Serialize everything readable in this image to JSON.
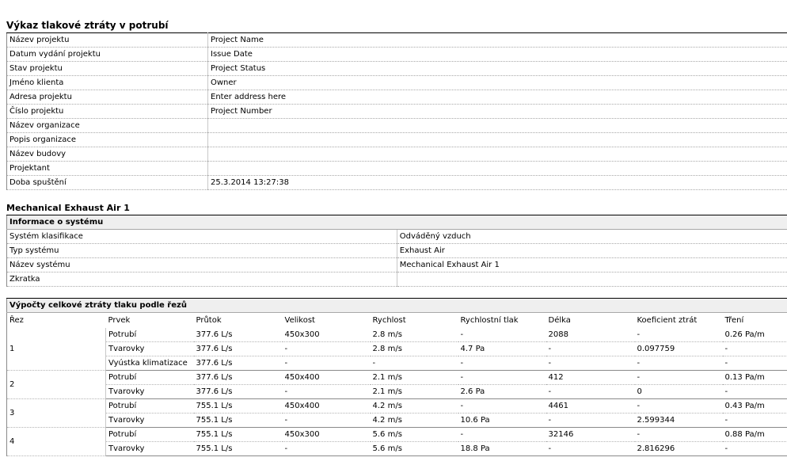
{
  "report_title": "Výkaz tlakové ztráty v potrubí",
  "project_info": [
    {
      "label": "Název projektu",
      "value": "Project Name"
    },
    {
      "label": "Datum vydání projektu",
      "value": "Issue Date"
    },
    {
      "label": "Stav projektu",
      "value": "Project Status"
    },
    {
      "label": "Jméno klienta",
      "value": "Owner"
    },
    {
      "label": "Adresa projektu",
      "value": "Enter address here"
    },
    {
      "label": "Číslo projektu",
      "value": "Project Number"
    },
    {
      "label": "Název organizace",
      "value": ""
    },
    {
      "label": "Popis organizace",
      "value": ""
    },
    {
      "label": "Název budovy",
      "value": ""
    },
    {
      "label": "Projektant",
      "value": ""
    },
    {
      "label": "Doba spuštění",
      "value": "25.3.2014 13:27:38"
    }
  ],
  "system": {
    "name": "Mechanical Exhaust Air 1",
    "info_header": "Informace o systému",
    "info": [
      {
        "label": "Systém klasifikace",
        "value": "Odváděný vzduch"
      },
      {
        "label": "Typ systému",
        "value": "Exhaust Air"
      },
      {
        "label": "Název systému",
        "value": "Mechanical Exhaust Air 1"
      },
      {
        "label": "Zkratka",
        "value": ""
      }
    ]
  },
  "pressure_calc": {
    "title": "Výpočty celkové ztráty tlaku podle řezů",
    "columns": [
      "Řez",
      "Prvek",
      "Průtok",
      "Velikost",
      "Rychlost",
      "Rychlostní tlak",
      "Délka",
      "Koeficient ztrát",
      "Tření"
    ],
    "sections": [
      {
        "id": "1",
        "rows": [
          {
            "prvek": "Potrubí",
            "prutok": "377.6 L/s",
            "velikost": "450x300",
            "rychlost": "2.8 m/s",
            "tlak": "-",
            "delka": "2088",
            "koef": "-",
            "treni": "0.26 Pa/m"
          },
          {
            "prvek": "Tvarovky",
            "prutok": "377.6 L/s",
            "velikost": "-",
            "rychlost": "2.8 m/s",
            "tlak": "4.7 Pa",
            "delka": "-",
            "koef": "0.097759",
            "treni": "-"
          },
          {
            "prvek": "Vyústka klimatizace",
            "prutok": "377.6 L/s",
            "velikost": "-",
            "rychlost": "-",
            "tlak": "-",
            "delka": "-",
            "koef": "-",
            "treni": "-"
          }
        ]
      },
      {
        "id": "2",
        "rows": [
          {
            "prvek": "Potrubí",
            "prutok": "377.6 L/s",
            "velikost": "450x400",
            "rychlost": "2.1 m/s",
            "tlak": "-",
            "delka": "412",
            "koef": "-",
            "treni": "0.13 Pa/m"
          },
          {
            "prvek": "Tvarovky",
            "prutok": "377.6 L/s",
            "velikost": "-",
            "rychlost": "2.1 m/s",
            "tlak": "2.6 Pa",
            "delka": "-",
            "koef": "0",
            "treni": "-"
          }
        ]
      },
      {
        "id": "3",
        "rows": [
          {
            "prvek": "Potrubí",
            "prutok": "755.1 L/s",
            "velikost": "450x400",
            "rychlost": "4.2 m/s",
            "tlak": "-",
            "delka": "4461",
            "koef": "-",
            "treni": "0.43 Pa/m"
          },
          {
            "prvek": "Tvarovky",
            "prutok": "755.1 L/s",
            "velikost": "-",
            "rychlost": "4.2 m/s",
            "tlak": "10.6 Pa",
            "delka": "-",
            "koef": "2.599344",
            "treni": "-"
          }
        ]
      },
      {
        "id": "4",
        "rows": [
          {
            "prvek": "Potrubí",
            "prutok": "755.1 L/s",
            "velikost": "450x300",
            "rychlost": "5.6 m/s",
            "tlak": "-",
            "delka": "32146",
            "koef": "-",
            "treni": "0.88 Pa/m"
          },
          {
            "prvek": "Tvarovky",
            "prutok": "755.1 L/s",
            "velikost": "-",
            "rychlost": "5.6 m/s",
            "tlak": "18.8 Pa",
            "delka": "-",
            "koef": "2.816296",
            "treni": "-"
          }
        ]
      }
    ]
  }
}
